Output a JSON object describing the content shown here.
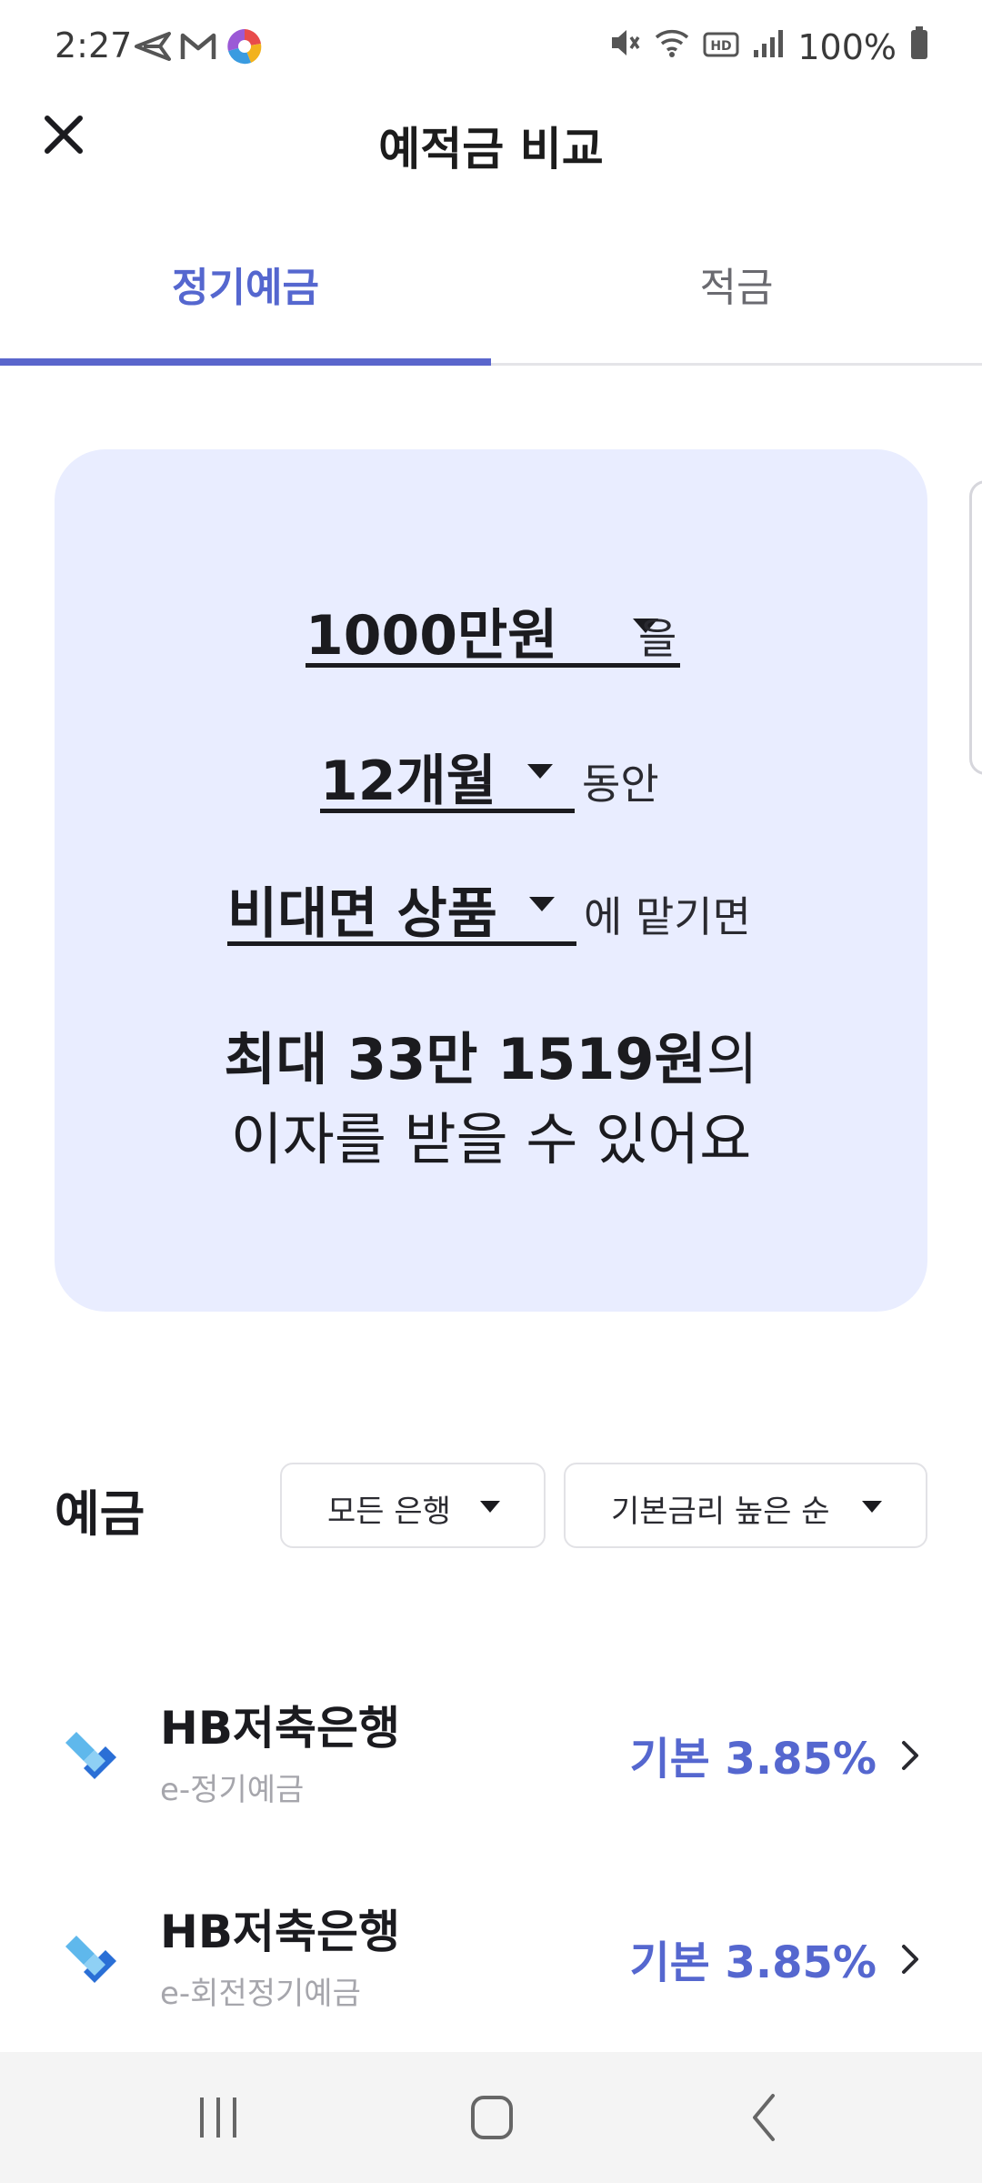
{
  "status_bar": {
    "time": "2:27",
    "battery": "100%",
    "left_icons": [
      "send-icon",
      "gmail-icon",
      "app-circle-icon"
    ],
    "right_icons": [
      "mute-icon",
      "wifi-icon",
      "hd-icon",
      "signal-icon",
      "battery-icon"
    ]
  },
  "header": {
    "title": "예적금 비교",
    "close_icon": "close-icon"
  },
  "tabs": [
    {
      "label": "정기예금",
      "active": true
    },
    {
      "label": "적금",
      "active": false
    }
  ],
  "summary": {
    "amount": {
      "value": "1000만원",
      "suffix": "을"
    },
    "period": {
      "value": "12개월",
      "suffix": "동안"
    },
    "product_type": {
      "value": "비대면 상품",
      "suffix": "에 맡기면"
    },
    "result_amount": "최대 33만 1519원",
    "result_particle": "의",
    "result_line2": "이자를 받을 수 있어요"
  },
  "section": {
    "title": "예금",
    "filters": [
      {
        "label": "모든 은행"
      },
      {
        "label": "기본금리 높은 순"
      }
    ]
  },
  "products": [
    {
      "bank": "HB저축은행",
      "product": "e-정기예금",
      "rate": "기본 3.85%"
    },
    {
      "bank": "HB저축은행",
      "product": "e-회전정기예금",
      "rate": "기본 3.85%"
    }
  ],
  "colors": {
    "accent": "#5567cf",
    "card_bg": "#e9edff",
    "logo_light": "#5fb8ec",
    "logo_dark": "#2a6fd6"
  },
  "nav_bar": {
    "icons": [
      "recent-apps-icon",
      "home-icon",
      "back-icon"
    ]
  }
}
